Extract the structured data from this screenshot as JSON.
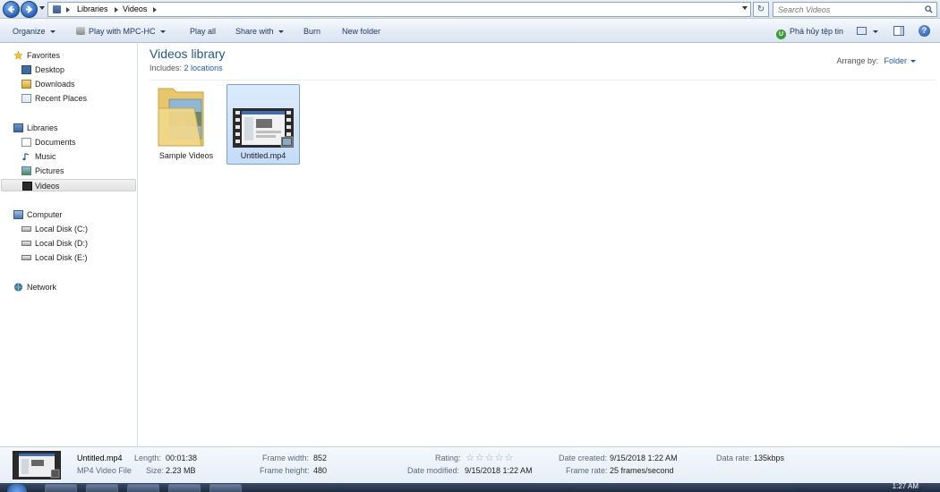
{
  "address_bar": {
    "breadcrumbs": [
      "Libraries",
      "Videos"
    ],
    "search_placeholder": "Search Videos"
  },
  "toolbar": {
    "organize": "Organize",
    "play_with": "Play with MPC-HC",
    "play_all": "Play all",
    "share_with": "Share with",
    "burn": "Burn",
    "new_folder": "New folder",
    "pha_huy": "Phá hủy tệp tin"
  },
  "sidebar": {
    "favorites": "Favorites",
    "favorites_items": [
      "Desktop",
      "Downloads",
      "Recent Places"
    ],
    "libraries": "Libraries",
    "libraries_items": [
      "Documents",
      "Music",
      "Pictures",
      "Videos"
    ],
    "computer": "Computer",
    "computer_items": [
      "Local Disk (C:)",
      "Local Disk (D:)",
      "Local Disk (E:)"
    ],
    "network": "Network",
    "selected": "Videos"
  },
  "content": {
    "title": "Videos library",
    "includes_label": "Includes:",
    "includes_link": "2 locations",
    "arrange_label": "Arrange by:",
    "arrange_value": "Folder",
    "items": [
      {
        "name": "Sample Videos",
        "type": "folder"
      },
      {
        "name": "Untitled.mp4",
        "type": "video",
        "selected": true
      }
    ]
  },
  "details": {
    "name": "Untitled.mp4",
    "type": "MP4 Video File",
    "length_label": "Length:",
    "length": "00:01:38",
    "size_label": "Size:",
    "size": "2.23 MB",
    "frame_width_label": "Frame width:",
    "frame_width": "852",
    "frame_height_label": "Frame height:",
    "frame_height": "480",
    "rating_label": "Rating:",
    "rating_stars": 0,
    "date_modified_label": "Date modified:",
    "date_modified": "9/15/2018 1:22 AM",
    "date_created_label": "Date created:",
    "date_created": "9/15/2018 1:22 AM",
    "frame_rate_label": "Frame rate:",
    "frame_rate": "25 frames/second",
    "data_rate_label": "Data rate:",
    "data_rate": "135kbps"
  },
  "taskbar": {
    "clock": "1:27 AM"
  },
  "colors": {
    "accent": "#1e5a8c",
    "link": "#1c5ab8",
    "selection": "#cfe3fb"
  }
}
